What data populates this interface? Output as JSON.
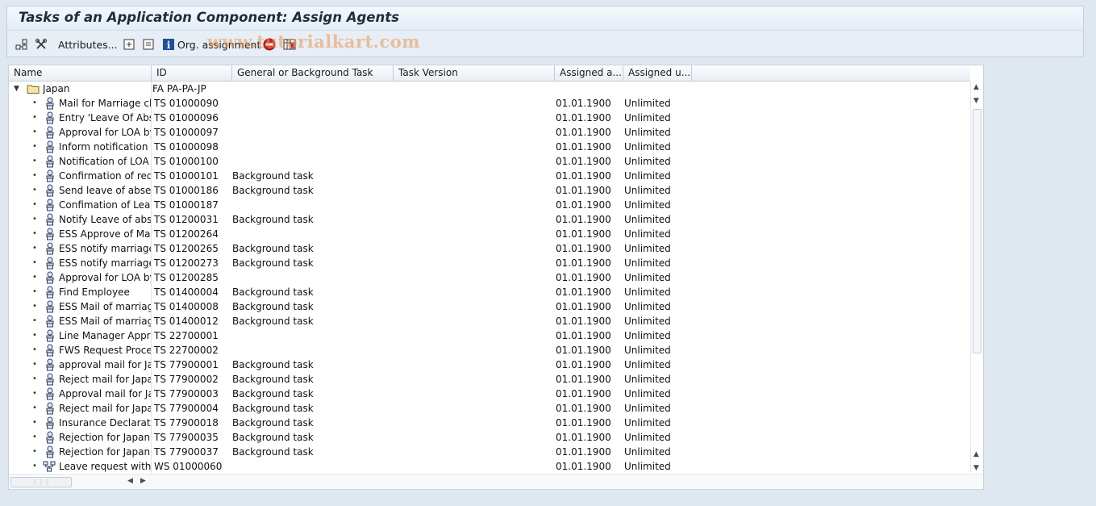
{
  "window": {
    "title": "Tasks of an Application Component: Assign Agents"
  },
  "toolbar": {
    "attributes_label": "Attributes...",
    "org_assignment_label": "Org. assignment",
    "watermark": "www.tutorialkart.com"
  },
  "columns": [
    "Name",
    "ID",
    "General or Background Task",
    "Task Version",
    "Assigned a...",
    "Assigned u..."
  ],
  "root": {
    "name": "Japan",
    "id": "FA PA-PA-JP"
  },
  "rows": [
    {
      "name": "Mail for Marriage chan",
      "id": "TS 01000090",
      "task": "",
      "version": "",
      "assigned_from": "01.01.1900",
      "assigned_until": "Unlimited",
      "icon": "person-task-icon"
    },
    {
      "name": "Entry 'Leave Of Abse",
      "id": "TS 01000096",
      "task": "",
      "version": "",
      "assigned_from": "01.01.1900",
      "assigned_until": "Unlimited",
      "icon": "person-task-icon"
    },
    {
      "name": "Approval for LOA by",
      "id": "TS 01000097",
      "task": "",
      "version": "",
      "assigned_from": "01.01.1900",
      "assigned_until": "Unlimited",
      "icon": "person-task-icon"
    },
    {
      "name": "Inform notification of",
      "id": "TS 01000098",
      "task": "",
      "version": "",
      "assigned_from": "01.01.1900",
      "assigned_until": "Unlimited",
      "icon": "person-task-icon"
    },
    {
      "name": "Notification of LOA r",
      "id": "TS 01000100",
      "task": "",
      "version": "",
      "assigned_from": "01.01.1900",
      "assigned_until": "Unlimited",
      "icon": "person-task-icon"
    },
    {
      "name": "Confirmation of requ",
      "id": "TS 01000101",
      "task": "Background task",
      "version": "",
      "assigned_from": "01.01.1900",
      "assigned_until": "Unlimited",
      "icon": "person-task-icon"
    },
    {
      "name": "Send leave of absenc",
      "id": "TS 01000186",
      "task": "Background task",
      "version": "",
      "assigned_from": "01.01.1900",
      "assigned_until": "Unlimited",
      "icon": "person-task-icon"
    },
    {
      "name": "Confimation of Leave",
      "id": "TS 01000187",
      "task": "",
      "version": "",
      "assigned_from": "01.01.1900",
      "assigned_until": "Unlimited",
      "icon": "person-task-icon"
    },
    {
      "name": "Notify Leave of abse",
      "id": "TS 01200031",
      "task": "Background task",
      "version": "",
      "assigned_from": "01.01.1900",
      "assigned_until": "Unlimited",
      "icon": "person-task-icon"
    },
    {
      "name": "ESS Approve of Marr",
      "id": "TS 01200264",
      "task": "",
      "version": "",
      "assigned_from": "01.01.1900",
      "assigned_until": "Unlimited",
      "icon": "person-task-icon"
    },
    {
      "name": "ESS notify marriage r",
      "id": "TS 01200265",
      "task": "Background task",
      "version": "",
      "assigned_from": "01.01.1900",
      "assigned_until": "Unlimited",
      "icon": "person-task-icon"
    },
    {
      "name": "ESS notify marriage r",
      "id": "TS 01200273",
      "task": "Background task",
      "version": "",
      "assigned_from": "01.01.1900",
      "assigned_until": "Unlimited",
      "icon": "person-task-icon"
    },
    {
      "name": "Approval for LOA by",
      "id": "TS 01200285",
      "task": "",
      "version": "",
      "assigned_from": "01.01.1900",
      "assigned_until": "Unlimited",
      "icon": "person-task-icon"
    },
    {
      "name": "Find Employee",
      "id": "TS 01400004",
      "task": "Background task",
      "version": "",
      "assigned_from": "01.01.1900",
      "assigned_until": "Unlimited",
      "icon": "person-task-icon"
    },
    {
      "name": "ESS Mail of marriage",
      "id": "TS 01400008",
      "task": "Background task",
      "version": "",
      "assigned_from": "01.01.1900",
      "assigned_until": "Unlimited",
      "icon": "person-task-icon"
    },
    {
      "name": "ESS Mail of marriage",
      "id": "TS 01400012",
      "task": "Background task",
      "version": "",
      "assigned_from": "01.01.1900",
      "assigned_until": "Unlimited",
      "icon": "person-task-icon"
    },
    {
      "name": "Line Manager Approv",
      "id": "TS 22700001",
      "task": "",
      "version": "",
      "assigned_from": "01.01.1900",
      "assigned_until": "Unlimited",
      "icon": "person-task-icon"
    },
    {
      "name": "FWS Request Proces",
      "id": "TS 22700002",
      "task": "",
      "version": "",
      "assigned_from": "01.01.1900",
      "assigned_until": "Unlimited",
      "icon": "person-task-icon"
    },
    {
      "name": "approval mail for Japa",
      "id": "TS 77900001",
      "task": "Background task",
      "version": "",
      "assigned_from": "01.01.1900",
      "assigned_until": "Unlimited",
      "icon": "person-task-icon"
    },
    {
      "name": "Reject mail for Japan",
      "id": "TS 77900002",
      "task": "Background task",
      "version": "",
      "assigned_from": "01.01.1900",
      "assigned_until": "Unlimited",
      "icon": "person-task-icon"
    },
    {
      "name": "Approval mail for Jap",
      "id": "TS 77900003",
      "task": "Background task",
      "version": "",
      "assigned_from": "01.01.1900",
      "assigned_until": "Unlimited",
      "icon": "person-task-icon"
    },
    {
      "name": "Reject mail for Japan",
      "id": "TS 77900004",
      "task": "Background task",
      "version": "",
      "assigned_from": "01.01.1900",
      "assigned_until": "Unlimited",
      "icon": "person-task-icon"
    },
    {
      "name": "Insurance Declaration",
      "id": "TS 77900018",
      "task": "Background task",
      "version": "",
      "assigned_from": "01.01.1900",
      "assigned_until": "Unlimited",
      "icon": "person-task-icon"
    },
    {
      "name": "Rejection for Japan I",
      "id": "TS 77900035",
      "task": "Background task",
      "version": "",
      "assigned_from": "01.01.1900",
      "assigned_until": "Unlimited",
      "icon": "person-task-icon"
    },
    {
      "name": "Rejection for Japan I",
      "id": "TS 77900037",
      "task": "Background task",
      "version": "",
      "assigned_from": "01.01.1900",
      "assigned_until": "Unlimited",
      "icon": "person-task-icon"
    },
    {
      "name": "Leave request with F",
      "id": "WS 01000060",
      "task": "",
      "version": "",
      "assigned_from": "01.01.1900",
      "assigned_until": "Unlimited",
      "icon": "workflow-icon"
    }
  ]
}
